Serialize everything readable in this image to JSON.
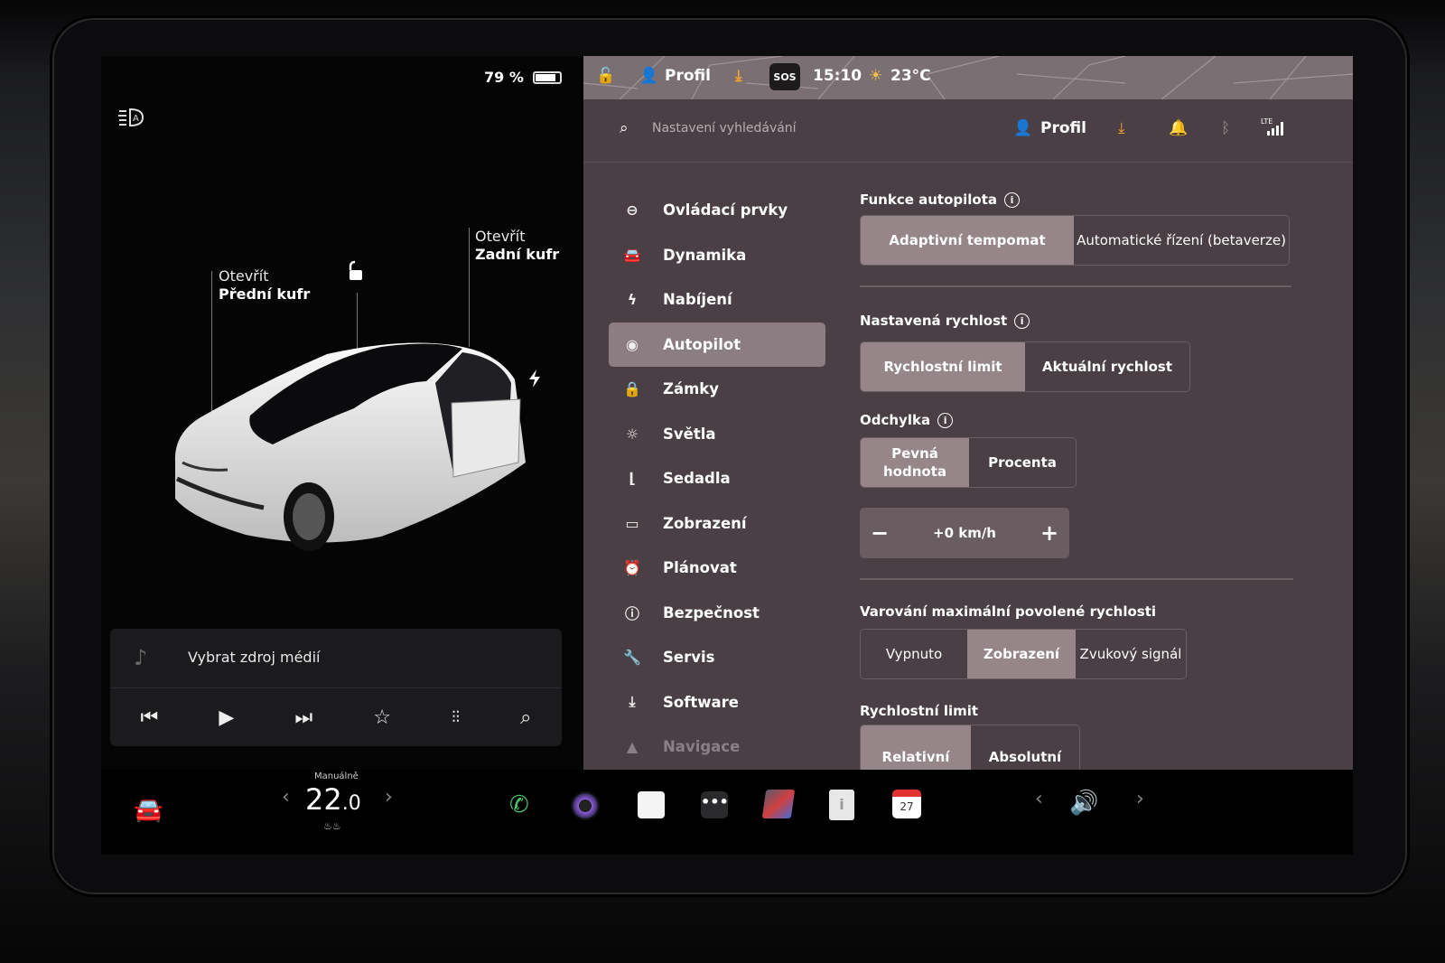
{
  "status": {
    "battery": "79 %",
    "time": "15:10",
    "temperature": "23°C",
    "profile": "Profil",
    "sos": "SOS"
  },
  "car": {
    "front_trunk_action": "Otevřít",
    "front_trunk": "Přední kufr",
    "rear_trunk_action": "Otevřít",
    "rear_trunk": "Zadní kufr"
  },
  "media": {
    "source_label": "Vybrat zdroj médií"
  },
  "search": {
    "placeholder": "Nastavení vyhledávání"
  },
  "header": {
    "profile": "Profil",
    "lte": "LTE"
  },
  "menu": [
    {
      "label": "Ovládací prvky",
      "icon": "toggle-icon"
    },
    {
      "label": "Dynamika",
      "icon": "car-icon"
    },
    {
      "label": "Nabíjení",
      "icon": "bolt-icon"
    },
    {
      "label": "Autopilot",
      "icon": "steering-wheel-icon"
    },
    {
      "label": "Zámky",
      "icon": "lock-icon"
    },
    {
      "label": "Světla",
      "icon": "sun-icon"
    },
    {
      "label": "Sedadla",
      "icon": "seat-icon"
    },
    {
      "label": "Zobrazení",
      "icon": "display-icon"
    },
    {
      "label": "Plánovat",
      "icon": "clock-icon"
    },
    {
      "label": "Bezpečnost",
      "icon": "alert-icon"
    },
    {
      "label": "Servis",
      "icon": "wrench-icon"
    },
    {
      "label": "Software",
      "icon": "download-icon"
    },
    {
      "label": "Navigace",
      "icon": "navigation-icon"
    }
  ],
  "autopilot": {
    "features_title": "Funkce autopilota",
    "features_options": [
      "Adaptivní tempomat",
      "Automatické řízení (betaverze)"
    ],
    "set_speed_title": "Nastavená rychlost",
    "set_speed_options": [
      "Rychlostní limit",
      "Aktuální rychlost"
    ],
    "offset_title": "Odchylka",
    "offset_options": [
      "Pevná hodnota",
      "Procenta"
    ],
    "offset_value": "+0 km/h",
    "warning_title": "Varování maximální povolené rychlosti",
    "warning_options": [
      "Vypnuto",
      "Zobrazení",
      "Zvukový signál"
    ],
    "limit_title": "Rychlostní limit",
    "limit_options": [
      "Relativní",
      "Absolutní"
    ]
  },
  "dock": {
    "climate_mode": "Manuálně",
    "temp_int": "22",
    "temp_dec": ".0",
    "calendar_day": "27"
  }
}
